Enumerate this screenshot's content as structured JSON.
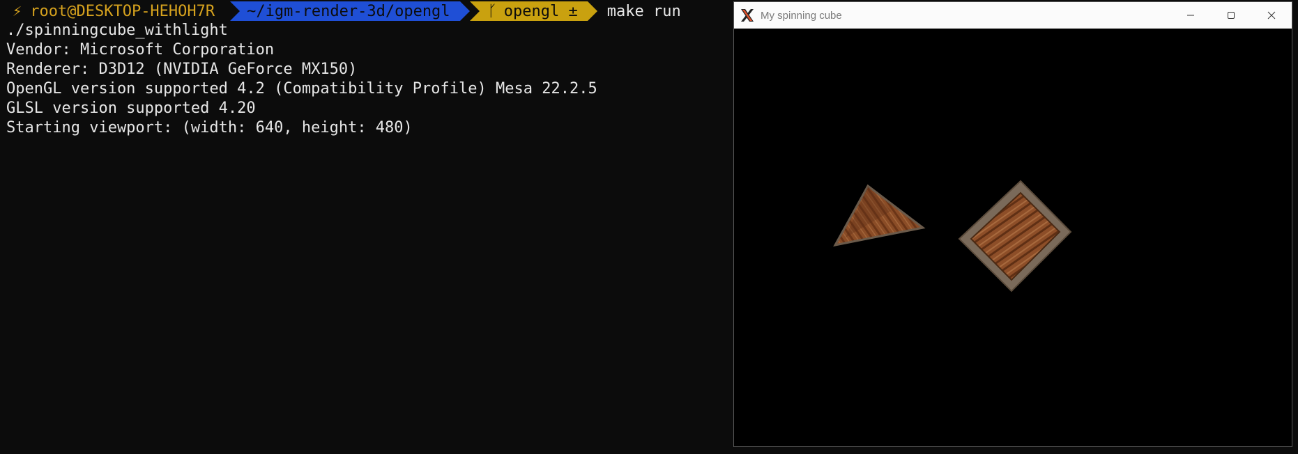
{
  "terminal": {
    "prompt": {
      "bolt": "⚡",
      "host": "root@DESKTOP-HEHOH7R",
      "path": "~/igm-render-3d/opengl",
      "branch_icon": "ᚴ",
      "branch": "opengl ±",
      "command": "make run"
    },
    "output": [
      "./spinningcube_withlight",
      "Vendor: Microsoft Corporation",
      "Renderer: D3D12 (NVIDIA GeForce MX150)",
      "OpenGL version supported 4.2 (Compatibility Profile) Mesa 22.2.5",
      "GLSL version supported 4.20",
      "Starting viewport: (width: 640, height: 480)"
    ],
    "colors": {
      "background": "#0c0c0c",
      "host_fg": "#d6a21e",
      "path_bg": "#1f4fd6",
      "branch_bg": "#c9a10f"
    }
  },
  "window": {
    "title": "My spinning cube",
    "icon": "x-window-system-icon",
    "controls": [
      "minimize-icon",
      "maximize-icon",
      "close-icon"
    ],
    "scene": {
      "background": "#000000",
      "objects": [
        "wooden-pyramid",
        "wooden-crate-cube"
      ]
    }
  }
}
